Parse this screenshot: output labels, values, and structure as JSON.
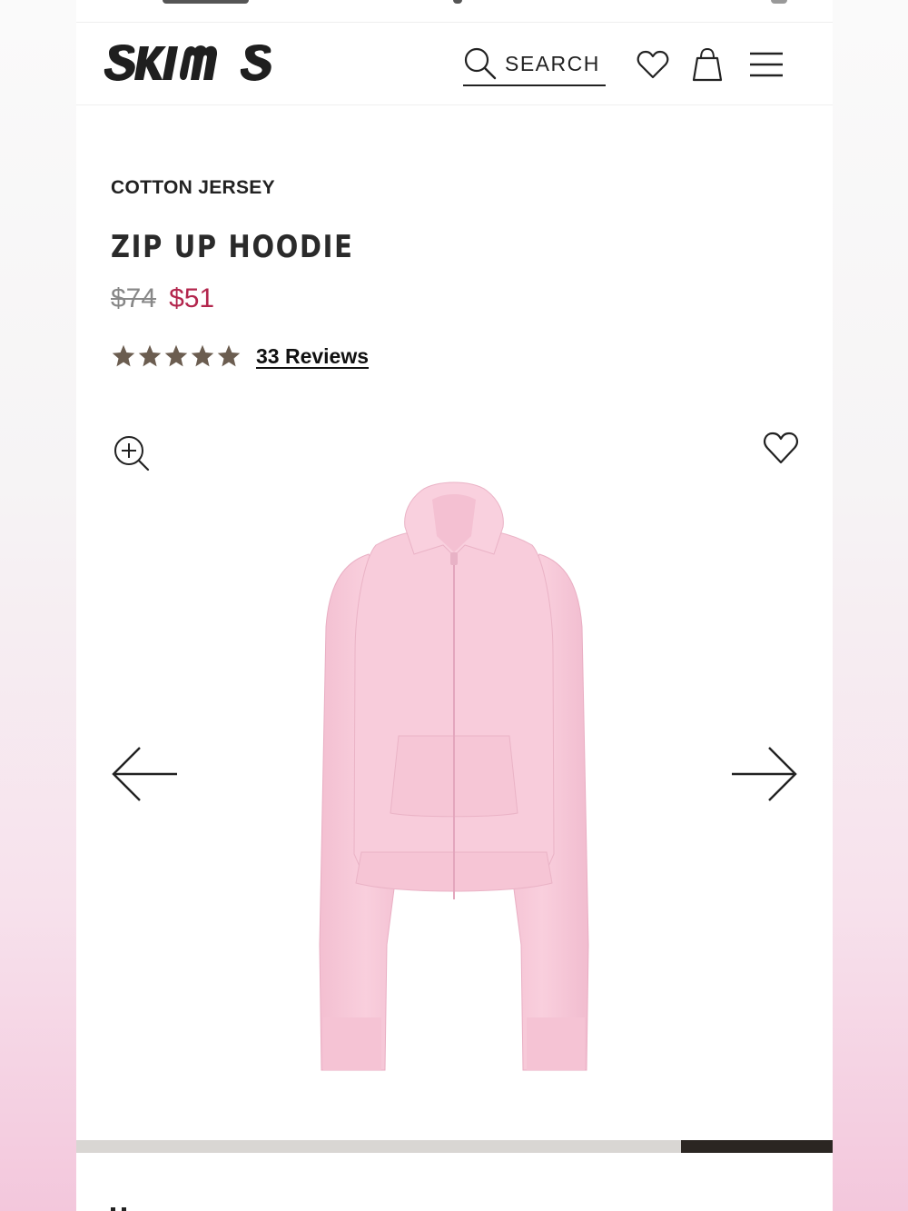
{
  "brand": {
    "logo_text": "SKIMS"
  },
  "header": {
    "search_label": "SEARCH",
    "icons": [
      "search-icon",
      "heart-icon",
      "shopping-bag-icon",
      "hamburger-menu-icon"
    ]
  },
  "product": {
    "category": "COTTON JERSEY",
    "name": "ZIP UP HOODIE",
    "price_original": "$74",
    "price_sale": "$51",
    "rating_stars": 5,
    "reviews_label": "33 Reviews",
    "image_alt": "Pink zip up hoodie"
  },
  "gallery": {
    "controls": [
      "zoom-in-icon",
      "heart-icon",
      "arrow-left-icon",
      "arrow-right-icon"
    ],
    "progress": {
      "start_fraction": 0.8,
      "end_fraction": 1.0
    }
  },
  "colors": {
    "sale_price": "#b3264d",
    "star": "#6b5d50",
    "progress_fill": "#2b2622",
    "progress_track": "#d9d6d3",
    "product": "#f6c6d6"
  }
}
